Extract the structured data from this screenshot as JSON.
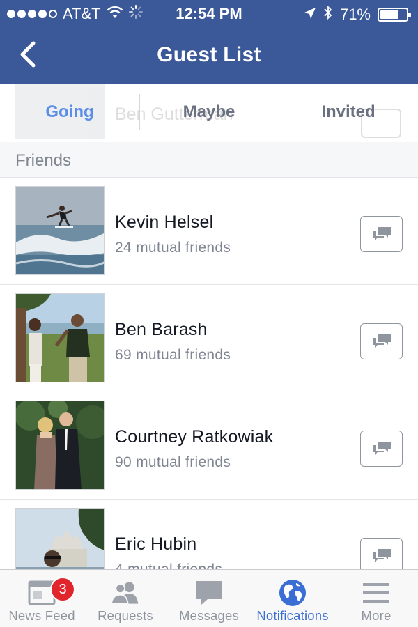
{
  "status_bar": {
    "carrier": "AT&T",
    "time": "12:54 PM",
    "battery": "71%",
    "battery_level": 0.71,
    "signal_bars": 4,
    "icons": [
      "wifi-icon",
      "loading-spinner-icon",
      "location-arrow-icon",
      "bluetooth-icon",
      "battery-icon"
    ]
  },
  "nav": {
    "title": "Guest List",
    "back_icon": "chevron-left-icon"
  },
  "tabs": [
    {
      "label": "Going",
      "active": true
    },
    {
      "label": "Maybe",
      "active": false
    },
    {
      "label": "Invited",
      "active": false
    }
  ],
  "ghost_row": {
    "name": "Ben Gutterman"
  },
  "section": {
    "title": "Friends"
  },
  "guests": [
    {
      "name": "Kevin Helsel",
      "mutual": "24 mutual friends"
    },
    {
      "name": "Ben Barash",
      "mutual": "69 mutual friends"
    },
    {
      "name": "Courtney Ratkowiak",
      "mutual": "90 mutual friends"
    },
    {
      "name": "Eric Hubin",
      "mutual": "4 mutual friends"
    }
  ],
  "tabbar": [
    {
      "label": "News Feed",
      "icon": "news-feed-icon",
      "badge": "3",
      "active": false
    },
    {
      "label": "Requests",
      "icon": "friend-requests-icon",
      "active": false
    },
    {
      "label": "Messages",
      "icon": "messages-icon",
      "active": false
    },
    {
      "label": "Notifications",
      "icon": "globe-icon",
      "active": true
    },
    {
      "label": "More",
      "icon": "menu-icon",
      "active": false
    }
  ],
  "colors": {
    "header": "#3b5998",
    "active_tab": "#5b8ee6",
    "badge": "#e0252c",
    "active_tabbar": "#3b6ed4"
  }
}
